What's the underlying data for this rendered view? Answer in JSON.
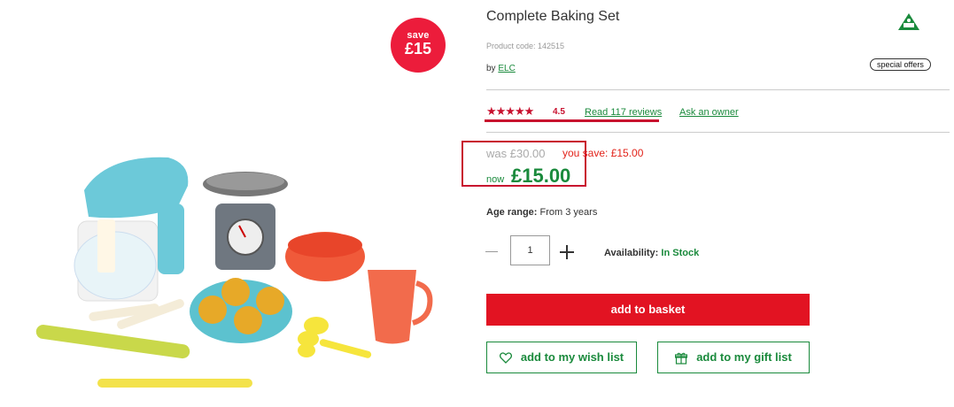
{
  "product": {
    "title": "Complete Baking Set",
    "code": "Product code: 142515",
    "by_label": "by",
    "brand": "ELC",
    "special_offers": "special offers",
    "save_badge": {
      "line1": "save",
      "line2": "£15"
    }
  },
  "reviews": {
    "stars": "★★★★★",
    "rating": "4.5",
    "read_link": "Read 117 reviews",
    "ask_link": "Ask an owner"
  },
  "price": {
    "was": "was £30.00",
    "you_save": "you save: £15.00",
    "now_label": "now",
    "now_value": "£15.00"
  },
  "details": {
    "age_label": "Age range:",
    "age_value": "From 3 years"
  },
  "purchase": {
    "quantity": "1",
    "availability_label": "Availability:",
    "availability_value": "In Stock",
    "add_to_basket": "add to basket",
    "wish_list": "add to my wish list",
    "gift_list": "add to my gift list"
  },
  "icons": [
    "brand-logo-icon",
    "star-icon",
    "minus-icon",
    "plus-icon",
    "heart-icon",
    "gift-icon"
  ],
  "colors": {
    "accent_red": "#e21322",
    "brand_green": "#1a8a3c",
    "badge_red": "#ec1c3b"
  }
}
